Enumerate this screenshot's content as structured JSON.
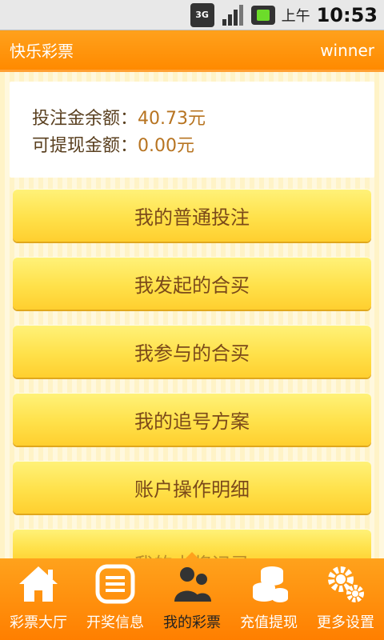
{
  "status_bar": {
    "network": "3G",
    "ampm": "上午",
    "time": "10:53"
  },
  "titlebar": {
    "app_title": "快乐彩票",
    "user": "winner"
  },
  "balance": {
    "bet_label": "投注金余额：",
    "bet_value": "40.73元",
    "withdraw_label": "可提现金额：",
    "withdraw_value": "0.00元"
  },
  "menu": [
    {
      "label": "我的普通投注"
    },
    {
      "label": "我发起的合买"
    },
    {
      "label": "我参与的合买"
    },
    {
      "label": "我的追号方案"
    },
    {
      "label": "账户操作明细"
    },
    {
      "label": "我的中奖记录"
    }
  ],
  "bottom_nav": [
    {
      "label": "彩票大厅",
      "icon": "home-icon"
    },
    {
      "label": "开奖信息",
      "icon": "list-icon"
    },
    {
      "label": "我的彩票",
      "icon": "users-icon",
      "active": true
    },
    {
      "label": "充值提现",
      "icon": "coins-icon"
    },
    {
      "label": "更多设置",
      "icon": "gears-icon"
    }
  ],
  "colors": {
    "accent_orange": "#ff8a00",
    "button_yellow": "#ffe14a",
    "button_text": "#7b4a1a",
    "value_text": "#b77421"
  }
}
